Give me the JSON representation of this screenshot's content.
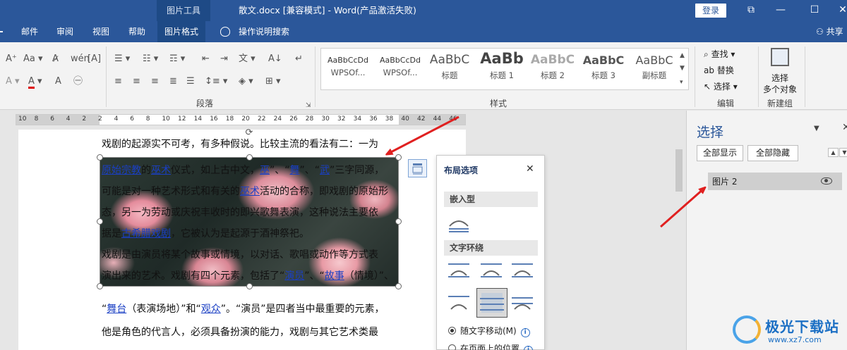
{
  "titlebar": {
    "context_tab": "图片工具",
    "doc_title": "散文.docx [兼容模式]  -  Word(产品激活失败)",
    "login": "登录",
    "window_buttons": [
      "restore-icon",
      "minimize-icon",
      "maximize-icon",
      "close-icon"
    ]
  },
  "tabs": {
    "items": [
      "邮件",
      "审阅",
      "视图",
      "帮助"
    ],
    "active": "图片格式",
    "search": "操作说明搜索",
    "share": "共享"
  },
  "ribbon": {
    "paragraph_label": "段落",
    "styles_label": "样式",
    "editing_label": "编辑",
    "newgroup_label": "新建组",
    "styles": [
      {
        "sample": "AaBbCcDd",
        "name": "WPSOf..."
      },
      {
        "sample": "AaBbCcDd",
        "name": "WPSOf..."
      },
      {
        "sample": "AaBbC",
        "name": "标题"
      },
      {
        "sample": "AaBb",
        "name": "标题 1"
      },
      {
        "sample": "AaBbC",
        "name": "标题 2"
      },
      {
        "sample": "AaBbC",
        "name": "标题 3"
      },
      {
        "sample": "AaBbC",
        "name": "副标题"
      }
    ],
    "find": "查找",
    "replace": "替换",
    "select": "选择",
    "select_objects": [
      "选择",
      "多个对象"
    ]
  },
  "ruler": {
    "numbers": [
      "10",
      "8",
      "6",
      "4",
      "2",
      "2",
      "4",
      "6",
      "8",
      "10",
      "12",
      "14",
      "16",
      "18",
      "20",
      "22",
      "24",
      "26",
      "28",
      "30",
      "32",
      "34",
      "36",
      "38",
      "40",
      "42",
      "44",
      "46"
    ]
  },
  "document": {
    "line1": "戏剧的起源实不可考，有多种假说。比较主流的看法有二：一为",
    "pic_lines": [
      {
        "parts": [
          {
            "t": "原始宗教",
            "link": true
          },
          {
            "t": "的"
          },
          {
            "t": "巫术",
            "link": true
          },
          {
            "t": "仪式，如上古中文，"
          },
          {
            "t": "巫",
            "link": true
          },
          {
            "t": "”、“"
          },
          {
            "t": "舞",
            "link": true
          },
          {
            "t": "”、“"
          },
          {
            "t": "武",
            "link": true
          },
          {
            "t": "”三字同源，"
          }
        ]
      },
      {
        "parts": [
          {
            "t": "可能是对一种艺术形式和有关的"
          },
          {
            "t": "巫术",
            "link": true
          },
          {
            "t": "活动的合称，即戏剧的原始形"
          }
        ]
      },
      {
        "parts": [
          {
            "t": "态，另一为劳动或庆祝丰收时的即兴歌舞表演，这种说法主要依"
          }
        ]
      },
      {
        "parts": [
          {
            "t": "据是"
          },
          {
            "t": "古希腊戏剧",
            "link": true
          },
          {
            "t": "，它被认为是起源于酒神祭祀。"
          }
        ]
      },
      {
        "parts": [
          {
            "t": "戏剧是由演员将某个故事或情境，以对话、歌唱或动作等方式表"
          }
        ]
      },
      {
        "parts": [
          {
            "t": "演出来的艺术。戏剧有四个元素，包括了“"
          },
          {
            "t": "演员",
            "link": true
          },
          {
            "t": "”、“"
          },
          {
            "t": "故事",
            "link": true
          },
          {
            "t": "（情境）”、"
          }
        ]
      }
    ],
    "line_after1_parts": [
      {
        "t": "“"
      },
      {
        "t": "舞台",
        "link": true
      },
      {
        "t": "（表演场地）”和“"
      },
      {
        "t": "观众",
        "link": true
      },
      {
        "t": "”。“演员”是四者当中最重要的元素，"
      }
    ],
    "line_after2": "他是角色的代言人，必须具备扮演的能力，戏剧与其它艺术类最"
  },
  "layout_popup": {
    "title": "布局选项",
    "inline_heading": "嵌入型",
    "wrap_heading": "文字环绕",
    "radio1": "随文字移动(M)",
    "radio2": "在页面上的位置"
  },
  "selection_pane": {
    "title": "选择",
    "show_all": "全部显示",
    "hide_all": "全部隐藏",
    "items": [
      "图片 2"
    ]
  },
  "watermark": {
    "brand": "极光下载站",
    "url": "www.xz7.com"
  },
  "colors": {
    "accent": "#2b579a",
    "annotation_arrow": "#e02020",
    "link": "#1a3fc4"
  }
}
